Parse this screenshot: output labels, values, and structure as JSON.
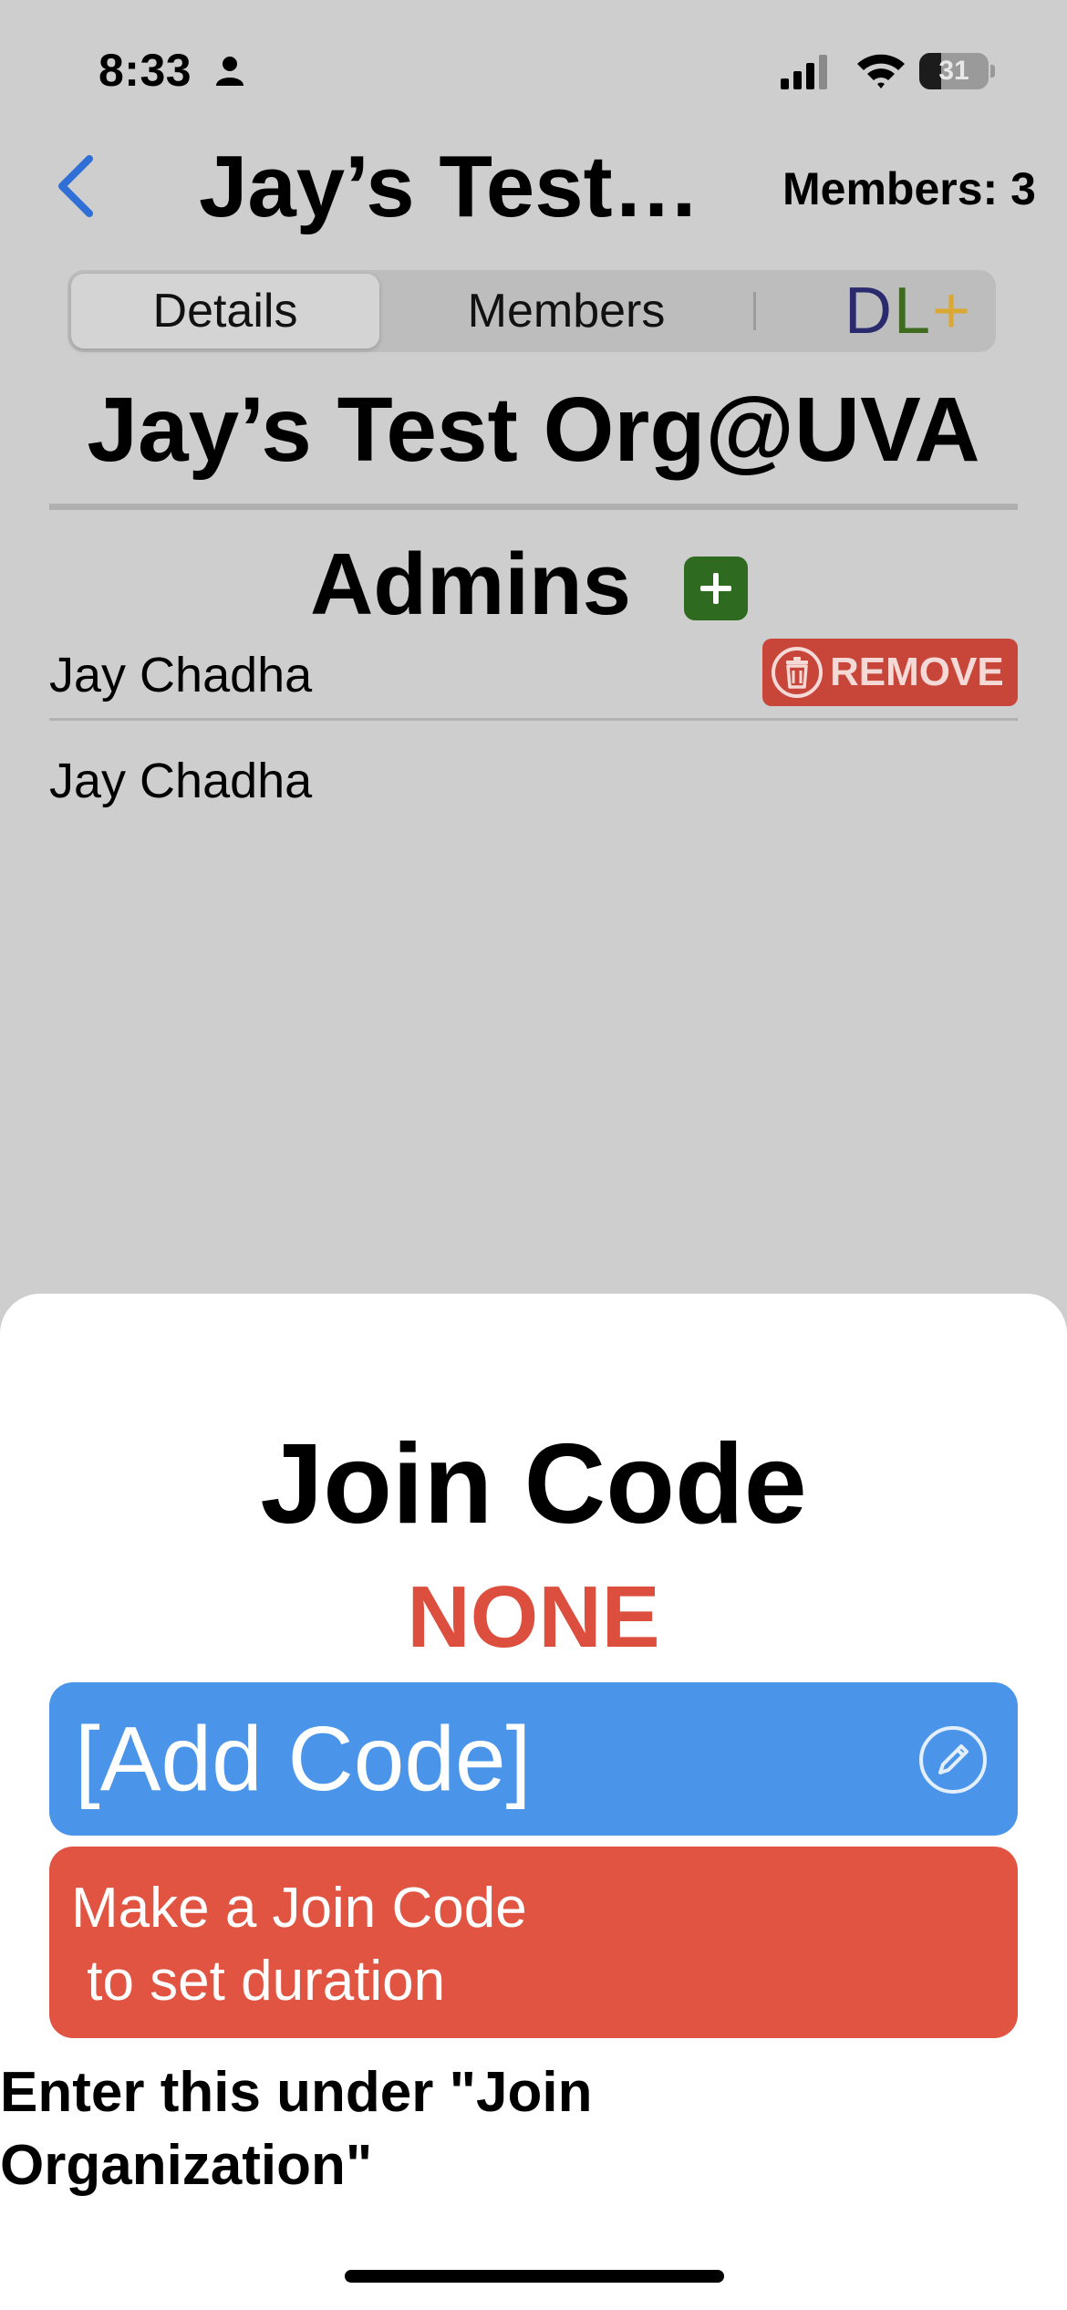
{
  "status_bar": {
    "time": "8:33",
    "battery_level": "31",
    "battery_fraction": 0.31
  },
  "nav": {
    "title": "Jay’s Test…",
    "members_count": "Members: 3"
  },
  "tabs": [
    {
      "label": "Details",
      "selected": true
    },
    {
      "label": "Members",
      "selected": false
    }
  ],
  "logo": {
    "d": "D",
    "l": "L",
    "plus": "+",
    "colors": {
      "d": "#2c2a6e",
      "l": "#3f6b1f",
      "plus": "#d9a934"
    }
  },
  "org": {
    "name": "Jay’s Test Org@UVA",
    "admins_header": "Admins",
    "admins": [
      {
        "name": "Jay Chadha"
      },
      {
        "name": "Jay Chadha"
      }
    ],
    "remove_label": "REMOVE"
  },
  "sheet": {
    "title": "Join Code",
    "code_value": "NONE",
    "add_code_label": "[Add Code]",
    "duration_text": "Make a Join Code\n to set duration",
    "hint": "Enter this under \"Join Organization\""
  },
  "colors": {
    "accent_blue": "#4a95ea",
    "danger_red": "#e15442",
    "add_green": "#2e6a20"
  }
}
